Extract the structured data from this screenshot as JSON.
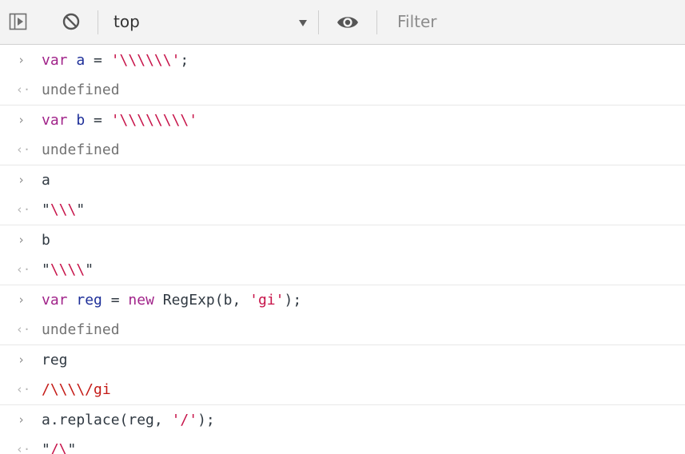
{
  "toolbar": {
    "context": "top",
    "filter_placeholder": "Filter",
    "icons": {
      "sidebar": "sidebar-toggle-icon",
      "clear": "clear-console-icon",
      "dropdown": "triangle-down-icon",
      "eye": "eye-icon"
    }
  },
  "console": {
    "prompt_glyph": "›",
    "result_glyph": "‹·",
    "entries": [
      {
        "input": {
          "kw": "var",
          "var": "a",
          "op": " = ",
          "str": "'\\\\\\\\\\\\'",
          "end": ";"
        },
        "output": "undefined"
      },
      {
        "input": {
          "kw": "var",
          "var": "b",
          "op": " = ",
          "str": "'\\\\\\\\\\\\\\\\'"
        },
        "output": "undefined"
      },
      {
        "input": {
          "plain": "a"
        },
        "output": {
          "open": "\"",
          "str": "\\\\\\",
          "close": "\""
        }
      },
      {
        "input": {
          "plain": "b"
        },
        "output": {
          "open": "\"",
          "str": "\\\\\\\\",
          "close": "\""
        }
      },
      {
        "input": {
          "kw": "var",
          "var": "reg",
          "op": " = ",
          "kw2": "new",
          "mid": " RegExp(b, ",
          "str": "'gi'",
          "end": ");"
        },
        "output": "undefined"
      },
      {
        "input": {
          "plain": "reg"
        },
        "output": "/\\\\\\\\/gi"
      },
      {
        "input": {
          "pre": "a.replace(reg, ",
          "str": "'/'",
          "end": ");"
        },
        "output": {
          "open": "\"",
          "str": "/\\",
          "close": "\""
        }
      }
    ]
  },
  "colors": {
    "keyword": "#a1248a",
    "variable": "#1e2f99",
    "string": "#c7144a",
    "text": "#303942",
    "undefined": "#727272",
    "accent": "#4f8df5"
  }
}
